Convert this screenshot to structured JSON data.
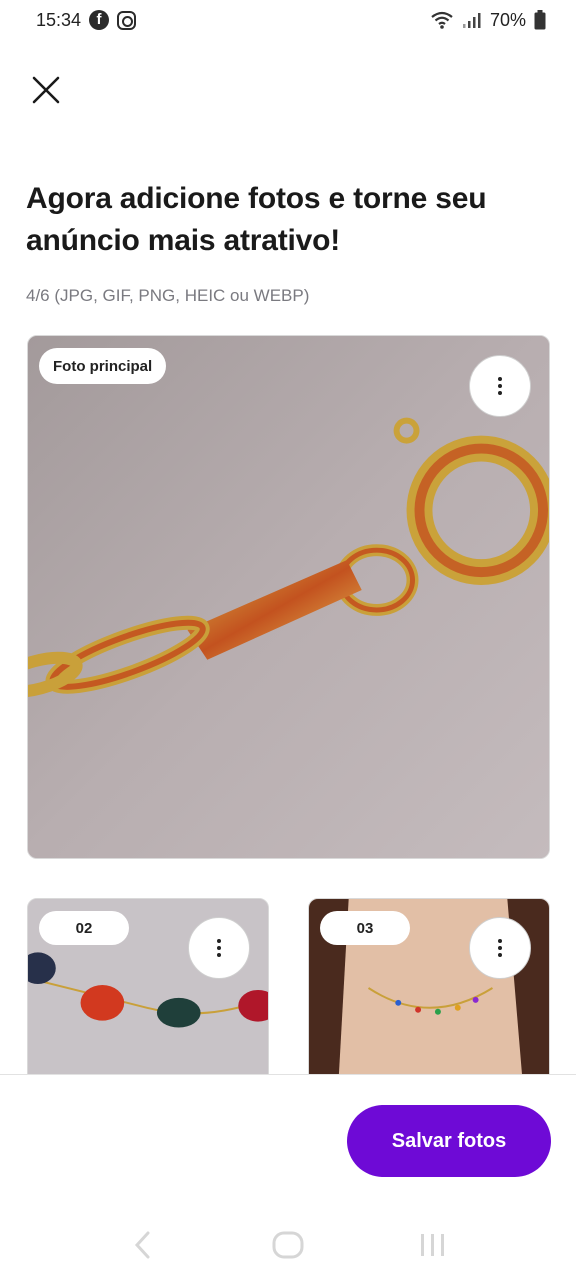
{
  "status_bar": {
    "time": "15:34",
    "battery": "70%",
    "icons": [
      "facebook-icon",
      "instagram-icon",
      "wifi-icon",
      "signal-icon",
      "battery-icon"
    ]
  },
  "header": {
    "close_icon": "close-icon",
    "title": "Agora adicione fotos e torne seu anúncio mais atrativo!",
    "subtitle": "4/6 (JPG, GIF, PNG, HEIC ou WEBP)"
  },
  "photos": {
    "main_badge": "Foto principal",
    "items": [
      {
        "badge": "02"
      },
      {
        "badge": "03"
      }
    ],
    "menu_icon": "more-vertical-icon"
  },
  "footer": {
    "save_label": "Salvar fotos"
  },
  "colors": {
    "accent": "#6e0ad6",
    "text": "#1a1a1a",
    "muted": "#7a7a80"
  }
}
